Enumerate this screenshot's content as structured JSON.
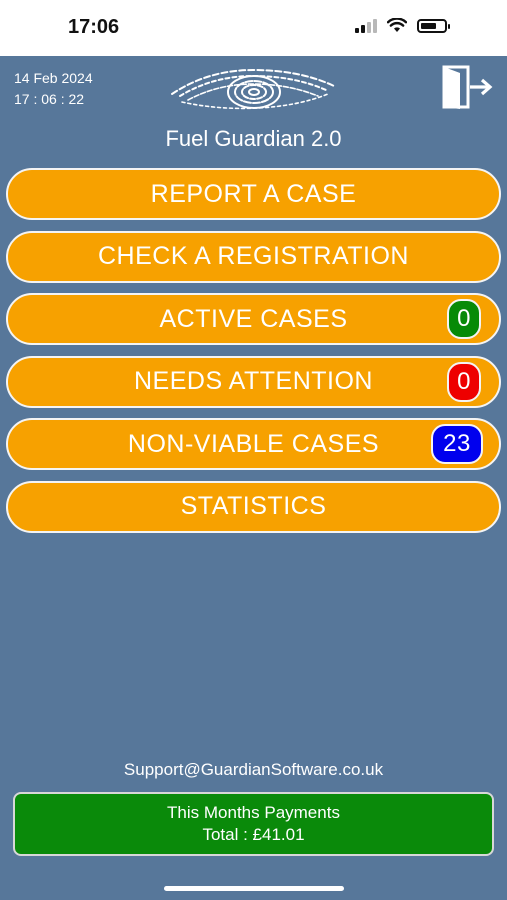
{
  "status_bar": {
    "time": "17:06",
    "battery_level": 0.7
  },
  "header": {
    "date": "14 Feb 2024",
    "time": "17 : 06 : 22",
    "title": "Fuel Guardian 2.0",
    "logo_icon": "eye-fingerprint-logo",
    "exit_icon": "logout-icon"
  },
  "menu": {
    "report": {
      "label": "REPORT A CASE"
    },
    "check": {
      "label": "CHECK A REGISTRATION"
    },
    "active": {
      "label": "ACTIVE CASES",
      "count": "0",
      "badge_color": "#078a07"
    },
    "attention": {
      "label": "NEEDS ATTENTION",
      "count": "0",
      "badge_color": "#ee0000"
    },
    "nonviable": {
      "label": "NON-VIABLE CASES",
      "count": "23",
      "badge_color": "#0000ee"
    },
    "statistics": {
      "label": "STATISTICS"
    }
  },
  "footer": {
    "support_email": "Support@GuardianSoftware.co.uk",
    "payments_title": "This Months Payments",
    "payments_total": "Total : £41.01"
  },
  "colors": {
    "background": "#57779a",
    "button": "#f7a100",
    "payments": "#0a8a0a"
  }
}
